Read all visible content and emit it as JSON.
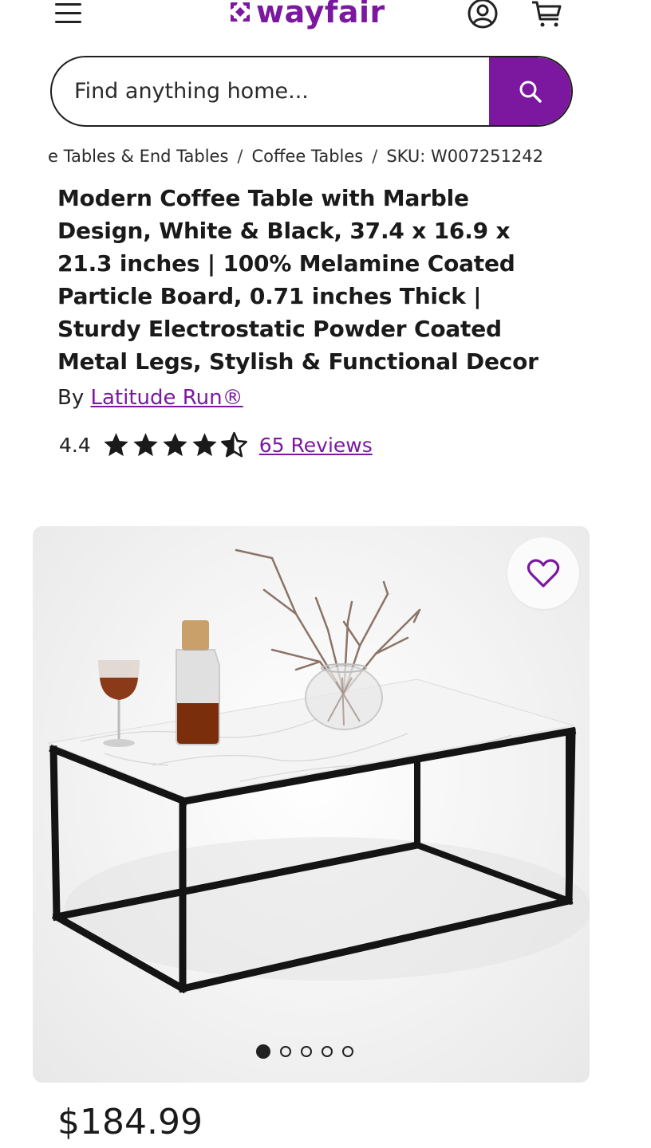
{
  "header": {
    "logo_text": "wayfair",
    "menu_icon": "hamburger-menu-icon",
    "account_icon": "account-icon",
    "cart_icon": "cart-icon",
    "brand_color": "#7b189f"
  },
  "search": {
    "placeholder": "Find anything home...",
    "value": "",
    "button_icon": "search-icon"
  },
  "breadcrumb": {
    "items": [
      "e Tables & End Tables",
      "Coffee Tables"
    ],
    "sku": "SKU: W007251242",
    "separator": "/"
  },
  "product": {
    "title": "Modern Coffee Table with Marble Design, White & Black, 37.4 x 16.9 x 21.3 inches | 100% Melamine Coated Particle Board, 0.71 inches Thick | Sturdy Electrostatic Powder Coated Metal Legs, Stylish & Functional Decor",
    "brand_prefix": "By",
    "brand_name": "Latitude Run®",
    "rating": "4.4",
    "rating_stars": 4.4,
    "rating_max": 5,
    "reviews_label": "65 Reviews",
    "price": "$184.99",
    "favorite_icon": "heart-outline-icon"
  },
  "gallery": {
    "total_images": 5,
    "active_index": 0
  }
}
